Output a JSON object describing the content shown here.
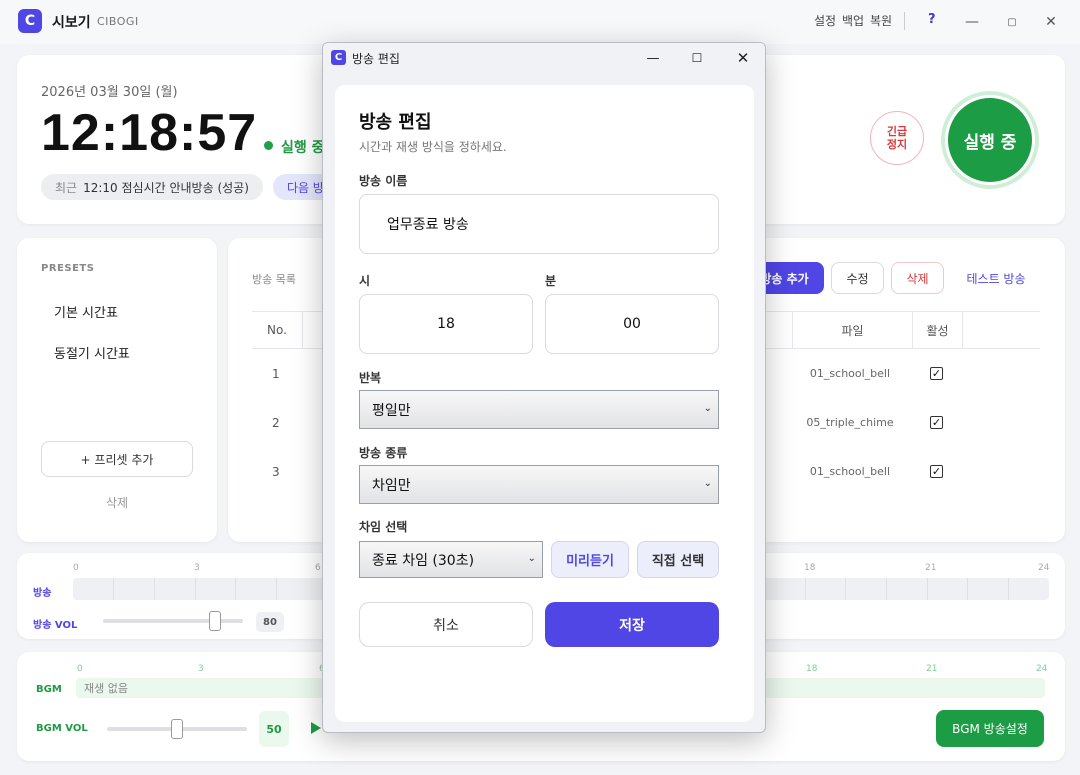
{
  "app": {
    "logo_letter": "C",
    "title": "시보기",
    "subtitle": "CIBOGI",
    "menu": [
      "설정",
      "백업",
      "복원"
    ],
    "help": "?",
    "accent_color": "#4f46e5",
    "success_color": "#1d9c46",
    "danger_color": "#d63a3a"
  },
  "status": {
    "date": "2026년 03월 30일 (월)",
    "time": "12:18:57",
    "state": "실행 중",
    "recent_label": "최근",
    "recent_value": "12:10 점심시간 안내방송 (성공)",
    "next_label": "다음 방",
    "emergency_label": "긴급\n정지",
    "run_button": "실행 중"
  },
  "presets": {
    "title": "PRESETS",
    "items": [
      "기본 시간표",
      "동절기 시간표"
    ],
    "add_label": "+ 프리셋 추가",
    "delete_label": "삭제"
  },
  "schedule": {
    "title": "방송 목록",
    "add_label": "방송 추가",
    "edit_label": "수정",
    "delete_label": "삭제",
    "test_label": "테스트 방송",
    "columns": [
      "No.",
      "파일",
      "활성"
    ],
    "rows": [
      {
        "no": "1",
        "file": "01_school_bell",
        "active": true
      },
      {
        "no": "2",
        "file": "05_triple_chime",
        "active": true
      },
      {
        "no": "3",
        "file": "01_school_bell",
        "active": true
      }
    ]
  },
  "timeline": {
    "ticks": [
      "0",
      "3",
      "6",
      "18",
      "21",
      "24"
    ],
    "label": "방송",
    "vol_label": "방송 VOL",
    "vol_value": "80",
    "vol_level": 80
  },
  "bgm": {
    "ticks": [
      "0",
      "3",
      "6",
      "18",
      "21",
      "24"
    ],
    "label": "BGM",
    "status": "재생 없음",
    "vol_label": "BGM VOL",
    "vol_value": "50",
    "vol_level": 50,
    "settings_button": "BGM 방송설정"
  },
  "dialog": {
    "window_title": "방송 편집",
    "heading": "방송 편집",
    "subheading": "시간과 재생 방식을 정하세요.",
    "name_label": "방송 이름",
    "name_value": "업무종료 방송",
    "hour_label": "시",
    "hour_value": "18",
    "minute_label": "분",
    "minute_value": "00",
    "repeat_label": "반복",
    "repeat_value": "평일만",
    "type_label": "방송 종류",
    "type_value": "차임만",
    "chime_label": "차임 선택",
    "chime_value": "종료 차임 (30초)",
    "preview_label": "미리듣기",
    "custom_label": "직접 선택",
    "cancel_label": "취소",
    "save_label": "저장"
  }
}
